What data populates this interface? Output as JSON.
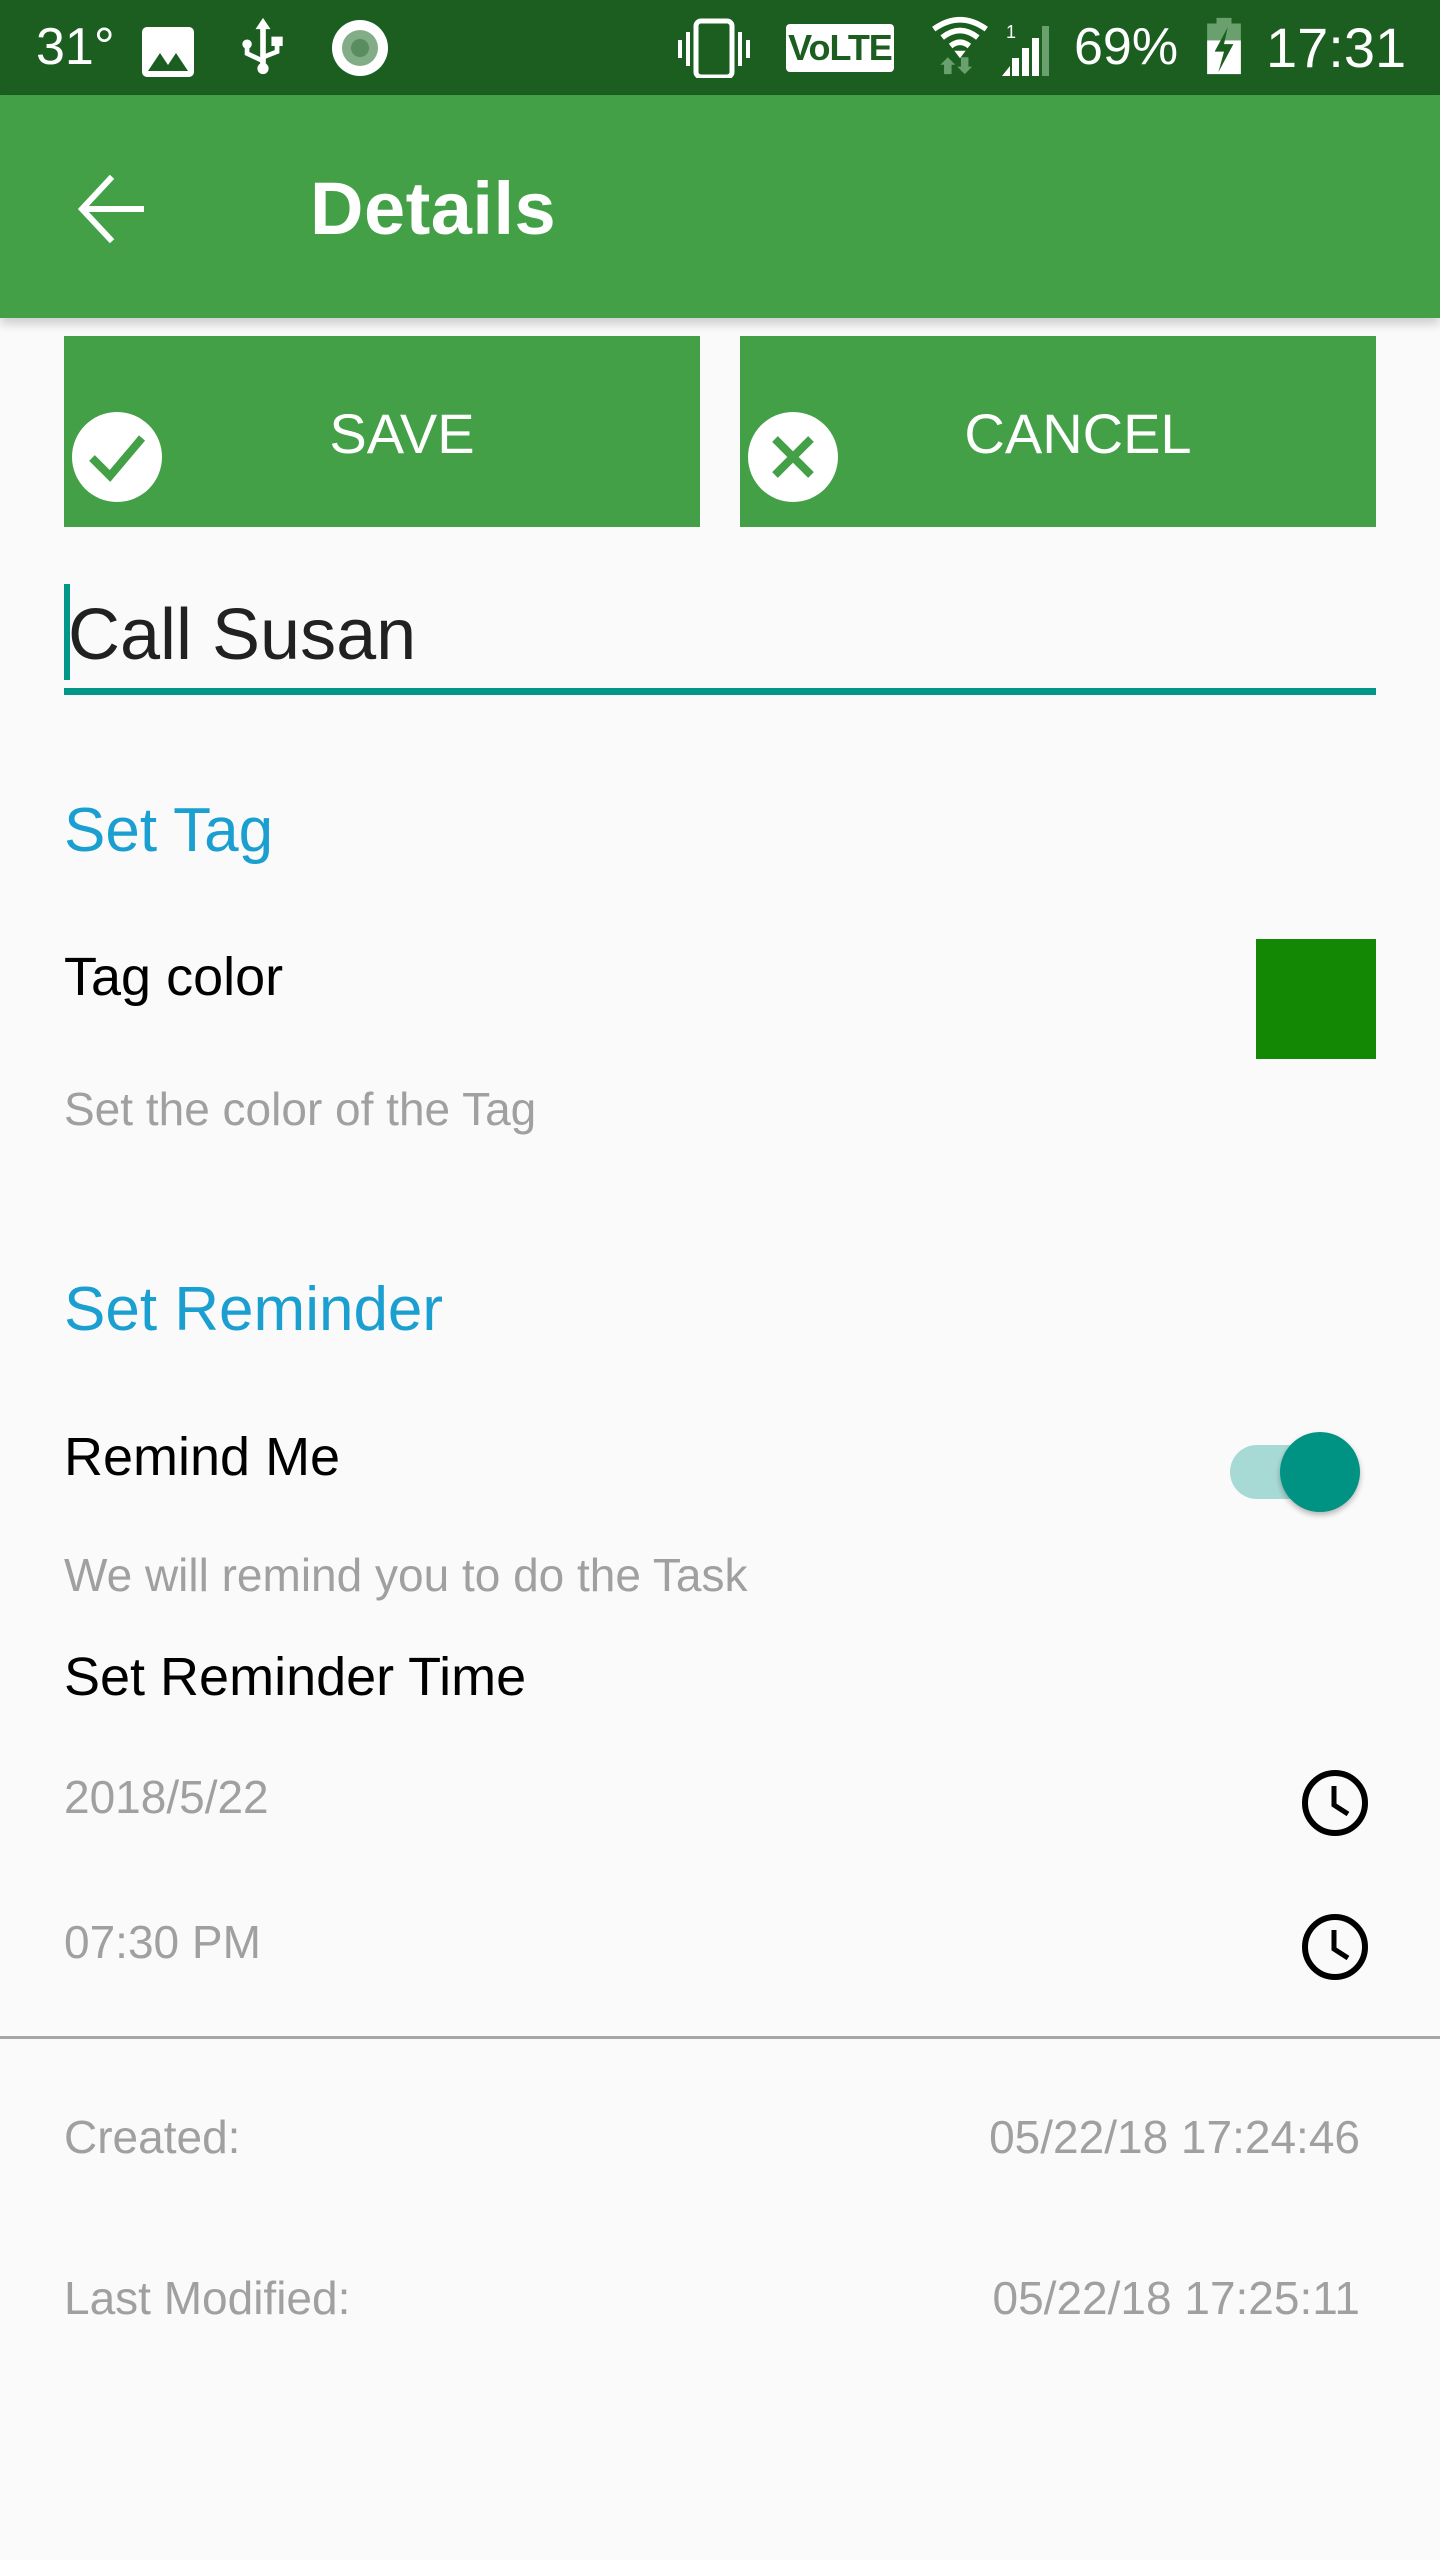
{
  "status_bar": {
    "temperature": "31°",
    "battery_percent": "69%",
    "time": "17:31",
    "volte_label": "VoLTE",
    "icons": [
      "image-notification-icon",
      "usb-icon",
      "record-icon",
      "vibrate-icon",
      "volte-icon",
      "wifi-icon",
      "signal-icon",
      "battery-charging-icon"
    ]
  },
  "app_bar": {
    "title": "Details",
    "back_icon": "arrow-left-icon"
  },
  "actions": {
    "save_label": "SAVE",
    "save_icon": "check-circle-icon",
    "cancel_label": "CANCEL",
    "cancel_icon": "close-circle-icon"
  },
  "task": {
    "title_value": "Call Susan"
  },
  "tag_section": {
    "heading": "Set Tag",
    "tag_color_title": "Tag color",
    "tag_color_summary": "Set the color of the Tag",
    "tag_color_value": "#138805"
  },
  "reminder_section": {
    "heading": "Set Reminder",
    "remind_me_title": "Remind Me",
    "remind_me_summary": "We will remind you to do the Task",
    "remind_me_enabled": true,
    "reminder_time_title": "Set Reminder Time",
    "date_value": "2018/5/22",
    "time_value": "07:30 PM",
    "date_icon": "clock-icon",
    "time_icon": "clock-icon"
  },
  "metadata": {
    "created_label": "Created:",
    "created_value": "05/22/18 17:24:46",
    "modified_label": "Last Modified:",
    "modified_value": "05/22/18 17:25:11"
  },
  "colors": {
    "status_bar": "#1b5e20",
    "primary": "#43a047",
    "accent": "#009688",
    "section_heading": "#1a9fd0",
    "secondary_text": "#a0a0a0"
  }
}
